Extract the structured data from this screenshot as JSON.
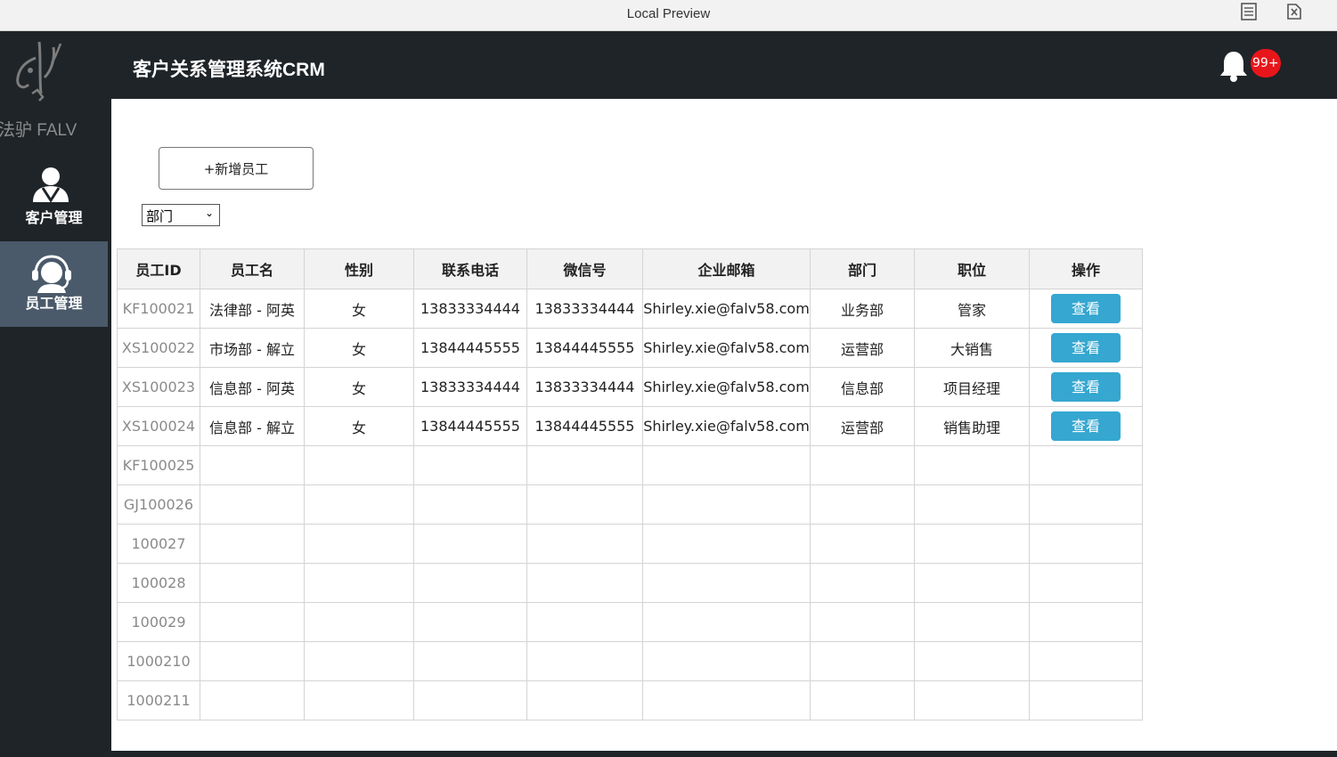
{
  "window": {
    "title": "Local Preview"
  },
  "sidebar": {
    "logo_text": "法驴 FALV",
    "items": [
      {
        "label": "客户管理",
        "icon": "customer-icon",
        "active": false
      },
      {
        "label": "员工管理",
        "icon": "headset-support-icon",
        "active": true
      }
    ]
  },
  "header": {
    "title": "客户关系管理系统CRM",
    "notification_badge": "99+"
  },
  "toolbar": {
    "add_label": "+新增员工",
    "dept_filter_value": "部门"
  },
  "table": {
    "columns": [
      "员工ID",
      "员工名",
      "性别",
      "联系电话",
      "微信号",
      "企业邮箱",
      "部门",
      "职位",
      "操作"
    ],
    "view_label": "查看",
    "rows": [
      {
        "id": "KF100021",
        "name": "法律部 - 阿英",
        "gender": "女",
        "phone": "13833334444",
        "wechat": "13833334444",
        "email": "Shirley.xie@falv58.com",
        "dept": "业务部",
        "position": "管家",
        "action": true
      },
      {
        "id": "XS100022",
        "name": "市场部 - 解立",
        "gender": "女",
        "phone": "13844445555",
        "wechat": "13844445555",
        "email": "Shirley.xie@falv58.com",
        "dept": "运营部",
        "position": "大销售",
        "action": true
      },
      {
        "id": "XS100023",
        "name": "信息部 - 阿英",
        "gender": "女",
        "phone": "13833334444",
        "wechat": "13833334444",
        "email": "Shirley.xie@falv58.com",
        "dept": "信息部",
        "position": "项目经理",
        "action": true
      },
      {
        "id": "XS100024",
        "name": "信息部 - 解立",
        "gender": "女",
        "phone": "13844445555",
        "wechat": "13844445555",
        "email": "Shirley.xie@falv58.com",
        "dept": "运营部",
        "position": "销售助理",
        "action": true
      },
      {
        "id": "KF100025",
        "name": "",
        "gender": "",
        "phone": "",
        "wechat": "",
        "email": "",
        "dept": "",
        "position": "",
        "action": false
      },
      {
        "id": "GJ100026",
        "name": "",
        "gender": "",
        "phone": "",
        "wechat": "",
        "email": "",
        "dept": "",
        "position": "",
        "action": false
      },
      {
        "id": "100027",
        "name": "",
        "gender": "",
        "phone": "",
        "wechat": "",
        "email": "",
        "dept": "",
        "position": "",
        "action": false
      },
      {
        "id": "100028",
        "name": "",
        "gender": "",
        "phone": "",
        "wechat": "",
        "email": "",
        "dept": "",
        "position": "",
        "action": false
      },
      {
        "id": "100029",
        "name": "",
        "gender": "",
        "phone": "",
        "wechat": "",
        "email": "",
        "dept": "",
        "position": "",
        "action": false
      },
      {
        "id": "1000210",
        "name": "",
        "gender": "",
        "phone": "",
        "wechat": "",
        "email": "",
        "dept": "",
        "position": "",
        "action": false
      },
      {
        "id": "1000211",
        "name": "",
        "gender": "",
        "phone": "",
        "wechat": "",
        "email": "",
        "dept": "",
        "position": "",
        "action": false
      }
    ]
  },
  "colors": {
    "sidebar_bg": "#1f2428",
    "active_nav": "#4a5a6b",
    "button_blue": "#35a7d0",
    "badge_red": "#e8161b"
  }
}
